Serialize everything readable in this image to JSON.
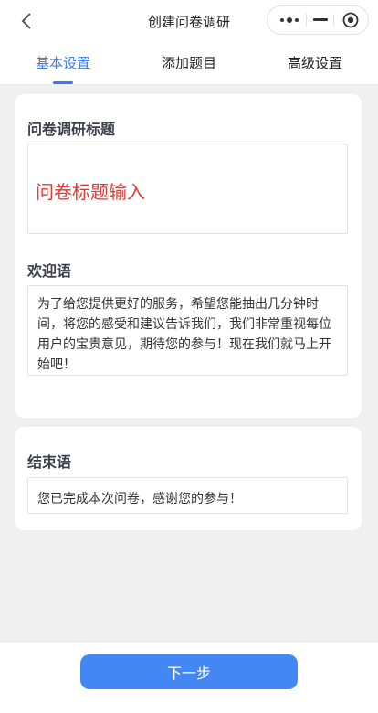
{
  "nav": {
    "title": "创建问卷调研",
    "back_icon": "chevron-left-icon",
    "more_icon": "more-dots-icon",
    "minimize_icon": "minimize-icon",
    "close_icon": "target-close-icon"
  },
  "tabs": [
    {
      "label": "基本设置",
      "active": true
    },
    {
      "label": "添加题目",
      "active": false
    },
    {
      "label": "高级设置",
      "active": false
    }
  ],
  "colors": {
    "accent": "#3b7be8",
    "button": "#4387f5",
    "placeholder_red": "#e53935"
  },
  "form": {
    "title_label": "问卷调研标题",
    "title_value": "问卷标题输入",
    "welcome_label": "欢迎语",
    "welcome_value": "为了给您提供更好的服务，希望您能抽出几分钟时间，将您的感受和建议告诉我们，我们非常重视每位用户的宝贵意见，期待您的参与！现在我们就马上开始吧！",
    "end_label": "结束语",
    "end_value": "您已完成本次问卷，感谢您的参与！"
  },
  "footer": {
    "next_label": "下一步"
  }
}
